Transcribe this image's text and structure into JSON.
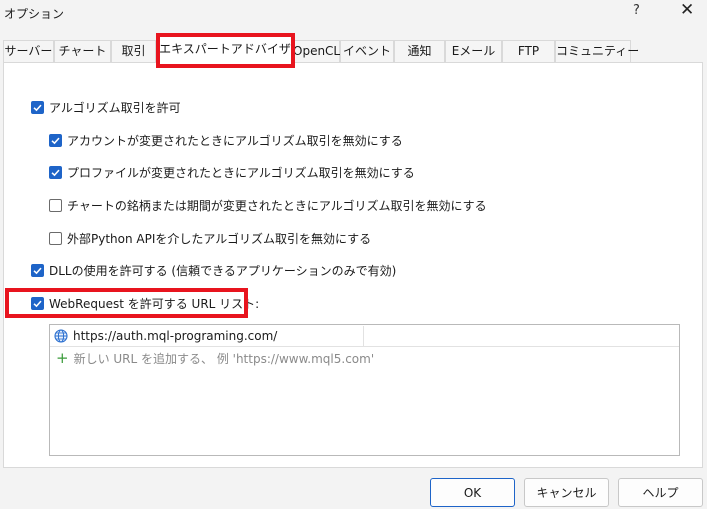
{
  "window": {
    "title": "オプション",
    "help_label": "?",
    "close_label": "✕"
  },
  "tabs": [
    {
      "label": "サーバー"
    },
    {
      "label": "チャート"
    },
    {
      "label": "取引"
    },
    {
      "label": "エキスパートアドバイザ",
      "selected": true
    },
    {
      "label": "OpenCL"
    },
    {
      "label": "イベント"
    },
    {
      "label": "通知"
    },
    {
      "label": "Eメール"
    },
    {
      "label": "FTP"
    },
    {
      "label": "コミュニティー"
    }
  ],
  "options": [
    {
      "label": "アルゴリズム取引を許可",
      "checked": true
    },
    {
      "label": "アカウントが変更されたときにアルゴリズム取引を無効にする",
      "checked": true
    },
    {
      "label": "プロファイルが変更されたときにアルゴリズム取引を無効にする",
      "checked": true
    },
    {
      "label": "チャートの銘柄または期間が変更されたときにアルゴリズム取引を無効にする",
      "checked": false
    },
    {
      "label": "外部Python APIを介したアルゴリズム取引を無効にする",
      "checked": false
    },
    {
      "label": "DLLの使用を許可する (信頼できるアプリケーションのみで有効)",
      "checked": true
    },
    {
      "label": "WebRequest を許可する URL リスト:",
      "checked": true
    }
  ],
  "url_list": {
    "entries": [
      "https://auth.mql-programing.com/"
    ],
    "add_placeholder": "新しい URL を追加する、 例 'https://www.mql5.com'"
  },
  "buttons": {
    "ok": "OK",
    "cancel": "キャンセル",
    "help": "ヘルプ"
  },
  "colors": {
    "accent": "#1e64c8",
    "highlight": "#e8141e",
    "add_icon": "#3a9b3a"
  }
}
